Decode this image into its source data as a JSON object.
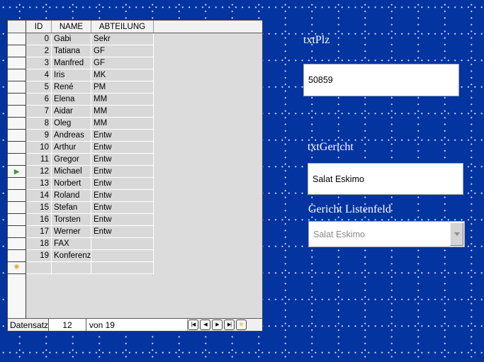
{
  "background": {
    "color": "#0434a0",
    "dot_color": "#e4eafc"
  },
  "grid_table": {
    "column_headers": {
      "id": "ID",
      "name": "NAME",
      "abteilung": "ABTEILUNG"
    },
    "rows": [
      {
        "id": "0",
        "name": "Gabi",
        "abteilung": "Sekr"
      },
      {
        "id": "2",
        "name": "Tatiana",
        "abteilung": "GF"
      },
      {
        "id": "3",
        "name": "Manfred",
        "abteilung": "GF"
      },
      {
        "id": "4",
        "name": "Iris",
        "abteilung": "MK"
      },
      {
        "id": "5",
        "name": "René",
        "abteilung": "PM"
      },
      {
        "id": "6",
        "name": "Elena",
        "abteilung": "MM"
      },
      {
        "id": "7",
        "name": "Aidar",
        "abteilung": "MM"
      },
      {
        "id": "8",
        "name": "Oleg",
        "abteilung": "MM"
      },
      {
        "id": "9",
        "name": "Andreas",
        "abteilung": "Entw"
      },
      {
        "id": "10",
        "name": "Arthur",
        "abteilung": "Entw"
      },
      {
        "id": "11",
        "name": "Gregor",
        "abteilung": "Entw"
      },
      {
        "id": "12",
        "name": "Michael",
        "abteilung": "Entw"
      },
      {
        "id": "13",
        "name": "Norbert",
        "abteilung": "Entw"
      },
      {
        "id": "14",
        "name": "Roland",
        "abteilung": "Entw"
      },
      {
        "id": "15",
        "name": "Stefan",
        "abteilung": "Entw"
      },
      {
        "id": "16",
        "name": "Torsten",
        "abteilung": "Entw"
      },
      {
        "id": "17",
        "name": "Werner",
        "abteilung": "Entw"
      },
      {
        "id": "18",
        "name": "FAX",
        "abteilung": ""
      },
      {
        "id": "19",
        "name": "Konferenz",
        "abteilung": ""
      }
    ],
    "current_row_index": 11,
    "icons": {
      "current_record_glyph": "▶",
      "new_record_glyph": "✳"
    }
  },
  "record_navigator": {
    "label": "Datensatz",
    "record_number": "12",
    "count_text": "von 19",
    "buttons": [
      {
        "name": "first-record-button",
        "glyph": "|◀"
      },
      {
        "name": "previous-record-button",
        "glyph": "◀"
      },
      {
        "name": "next-record-button",
        "glyph": "▶"
      },
      {
        "name": "last-record-button",
        "glyph": "▶|"
      },
      {
        "name": "new-record-button",
        "glyph": "✳"
      }
    ]
  },
  "form_controls": {
    "plz_label": "txtPlz",
    "plz_value": "50859",
    "gericht_label": "txtGericht",
    "gericht_value": "Salat Eskimo",
    "listbox_label": "Gericht Listenfeld",
    "listbox_value": "Salat Eskimo"
  }
}
